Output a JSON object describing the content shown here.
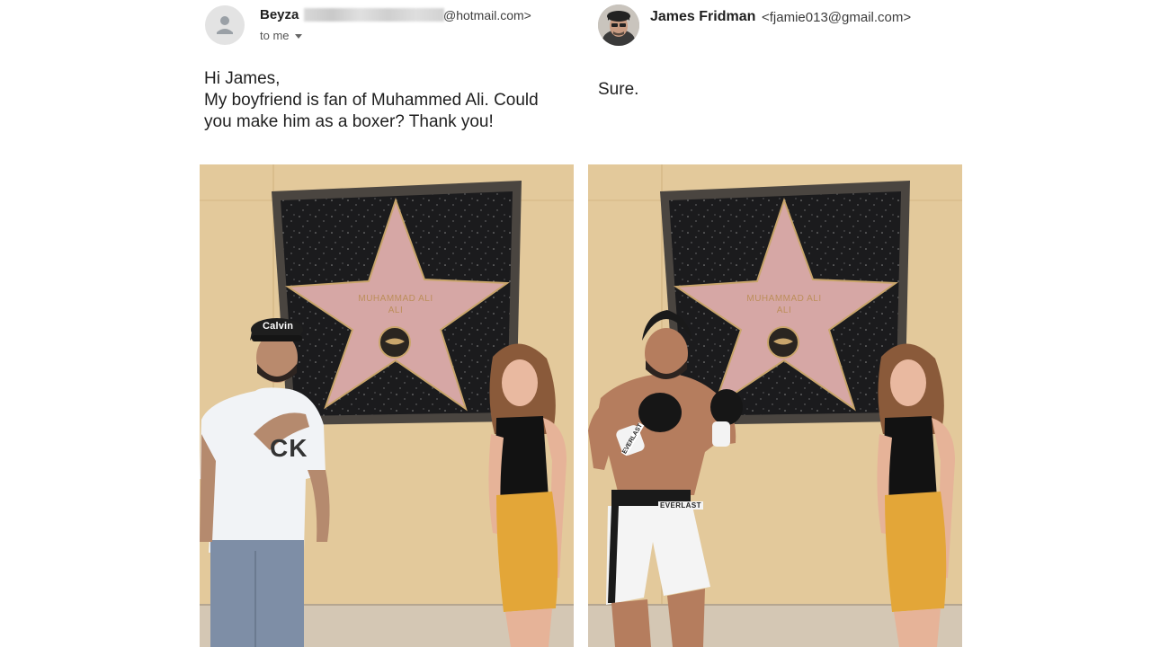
{
  "left_email": {
    "sender_name": "Beyza",
    "sender_email_suffix": "@hotmail.com>",
    "recipient": "to me",
    "message_lines": [
      "Hi James,",
      "My boyfriend is fan of Muhammed Ali. Could",
      "you make him as a boxer? Thank you!"
    ]
  },
  "right_email": {
    "sender_name": "James Fridman",
    "sender_email": "<fjamie013@gmail.com>",
    "message": "Sure."
  },
  "photos": {
    "star_name_line1": "MUHAMMAD ALI",
    "star_name_line2": "ALI",
    "cap_brand": "Calvin",
    "shirt_logo": "CK",
    "trunks_brand": "EVERLAST",
    "glove_brand": "EVERLAST"
  },
  "colors": {
    "wall": "#e3c99b",
    "star": "#d6a7a5",
    "plaque": "#1b1b1d",
    "accent_text": "#1f1f1f"
  },
  "icons": {
    "avatar_default": "person-silhouette-icon",
    "recipient_caret": "chevron-down-icon"
  }
}
